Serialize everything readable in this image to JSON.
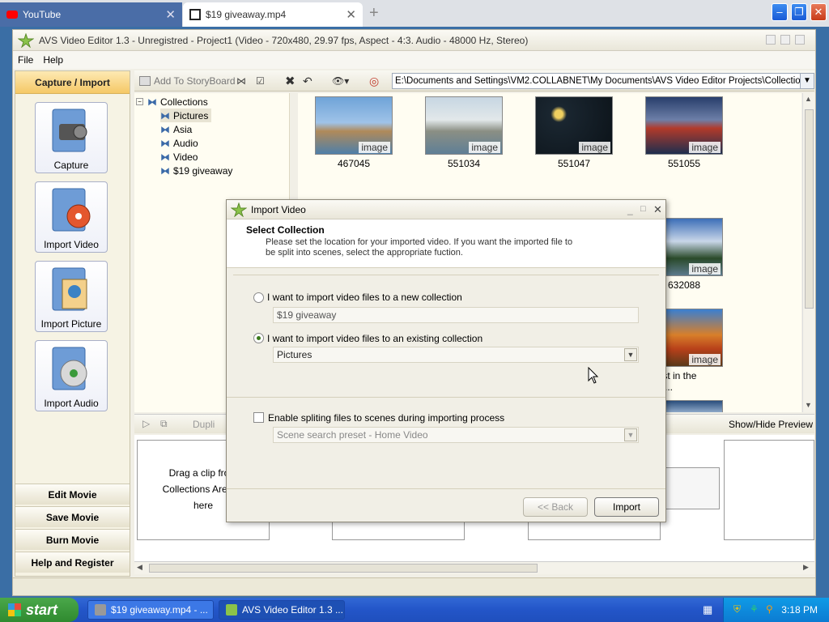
{
  "browser": {
    "tabs": [
      {
        "label": "YouTube"
      },
      {
        "label": "$19 giveaway.mp4"
      }
    ]
  },
  "app": {
    "title": "AVS Video Editor 1.3 - Unregistred - Project1 (Video - 720x480, 29.97 fps, Aspect - 4:3. Audio - 48000 Hz, Stereo)",
    "menu": [
      "File",
      "Help"
    ]
  },
  "left_panel": {
    "header": "Capture / Import",
    "buttons": [
      "Capture",
      "Import Video",
      "Import Picture",
      "Import Audio"
    ],
    "nav": [
      "Edit Movie",
      "Save Movie",
      "Burn Movie",
      "Help and Register"
    ]
  },
  "toolbar": {
    "add_to_storyboard": "Add To StoryBoard",
    "path": "E:\\Documents and Settings\\VM2.COLLABNET\\My Documents\\AVS Video Editor Projects\\Collections.ve"
  },
  "tree": {
    "root": "Collections",
    "children": [
      "Pictures",
      "Asia",
      "Audio",
      "Video",
      "$19 giveaway"
    ],
    "selected": "Pictures"
  },
  "grid": {
    "tag": "image",
    "items": [
      {
        "caption": "467045"
      },
      {
        "caption": "551034"
      },
      {
        "caption": "551047"
      },
      {
        "caption": "551055"
      },
      {
        "caption": "632088"
      },
      {
        "caption": "orest in the regi..."
      }
    ]
  },
  "lower": {
    "dup_label": "Dupli",
    "show_hide_preview": "Show/Hide Preview",
    "drag_text_1": "Drag a clip from",
    "drag_text_2": "Collections Area ar",
    "drag_text_3": "here"
  },
  "dialog": {
    "title": "Import Video",
    "heading": "Select Collection",
    "description_1": "Please set the location for your imported video. If you want the imported file to",
    "description_2": "be split into scenes, select the appropriate fuction.",
    "option_new": "I want to import video files to a new collection",
    "new_value": "$19 giveaway",
    "option_existing": "I want to import video files to an existing collection",
    "existing_value": "Pictures",
    "split_label": "Enable spliting files to scenes during importing process",
    "preset_value": "Scene search preset - Home Video",
    "back_label": "<< Back",
    "import_label": "Import"
  },
  "taskbar": {
    "start": "start",
    "tasks": [
      "$19 giveaway.mp4 - ...",
      "AVS Video Editor 1.3 ..."
    ],
    "clock": "3:18 PM"
  },
  "colors": {
    "accent_header": "#f5c866",
    "taskbar": "#2355c8",
    "start_green": "#3b9a3b"
  }
}
